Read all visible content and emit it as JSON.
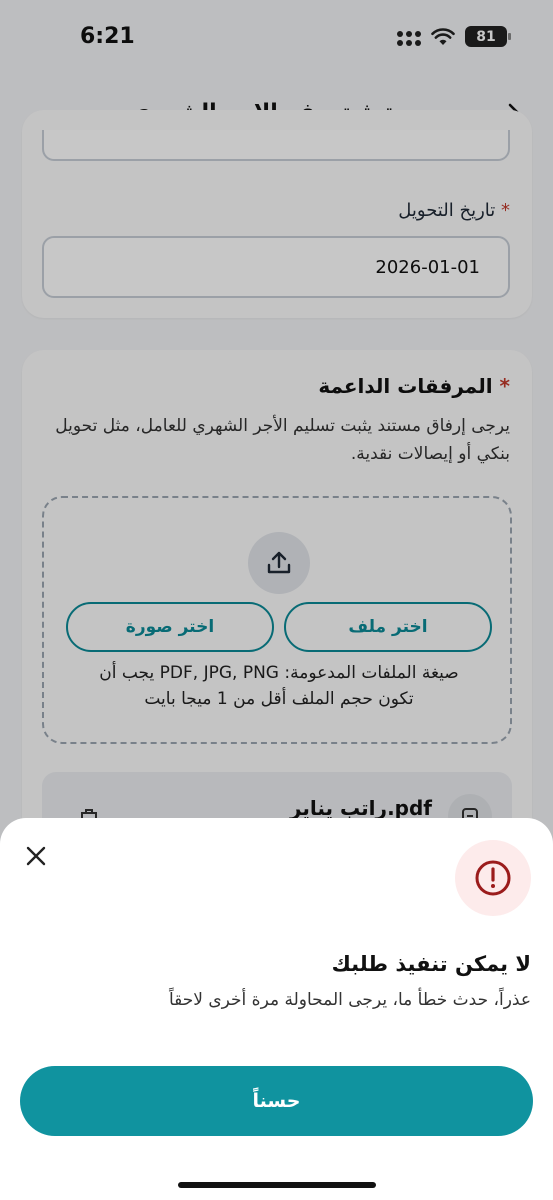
{
  "status_bar": {
    "time": "6:21",
    "battery": "81"
  },
  "header": {
    "title": "توثيق دفع الاجر الشهري"
  },
  "transfer": {
    "label": "تاريخ التحويل",
    "required_mark": "*",
    "date_value": "2026-01-01"
  },
  "attachments": {
    "title": "المرفقات الداعمة",
    "required_mark": "*",
    "description": "يرجى إرفاق مستند يثبت تسليم الأجر الشهري للعامل، مثل تحويل بنكي أو إيصالات نقدية.",
    "pick_file_label": "اختر ملف",
    "pick_image_label": "اختر صورة",
    "note_line1": "صيغة الملفات المدعومة: PDF, JPG, PNG يجب أن",
    "note_line2": "تكون حجم الملف أقل من 1 ميجا بايت",
    "file_name": "راتب يناير.pdf"
  },
  "sheet": {
    "title": "لا يمكن تنفيذ طلبك",
    "message": "عذراً، حدث خطأ ما، يرجى المحاولة مرة أخرى لاحقاً",
    "ok_label": "حسناً"
  },
  "colors": {
    "accent": "#10939f",
    "error": "#9b1c1c",
    "required": "#c0392b"
  }
}
